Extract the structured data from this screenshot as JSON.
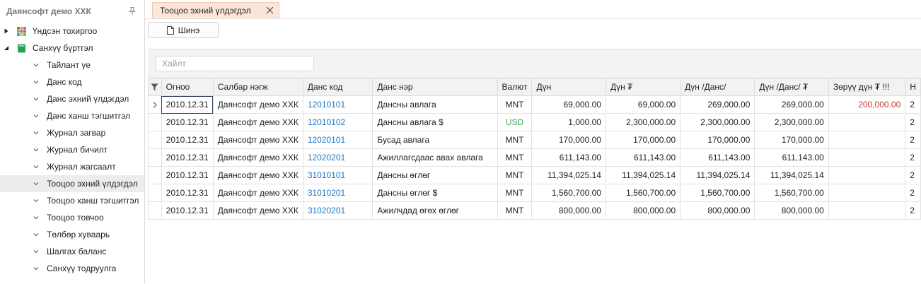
{
  "sidebar": {
    "title": "Даянсофт демо ХХК",
    "items": [
      {
        "label": "Үндсэн тохиргоо",
        "level": 0,
        "expanded": false
      },
      {
        "label": "Санхүү бүртгэл",
        "level": 0,
        "expanded": true
      },
      {
        "label": "Тайлант үе",
        "level": 1
      },
      {
        "label": "Данс код",
        "level": 1
      },
      {
        "label": "Данс эхний үлдэгдэл",
        "level": 1
      },
      {
        "label": "Данс ханш тэгшитгэл",
        "level": 1
      },
      {
        "label": "Журнал загвар",
        "level": 1
      },
      {
        "label": "Журнал бичилт",
        "level": 1
      },
      {
        "label": "Журнал жагсаалт",
        "level": 1
      },
      {
        "label": "Тооцоо эхний үлдэгдэл",
        "level": 1,
        "selected": true
      },
      {
        "label": "Тооцоо ханш тэгшитгэл",
        "level": 1
      },
      {
        "label": "Тооцоо товчоо",
        "level": 1
      },
      {
        "label": "Төлбөр хуваарь",
        "level": 1
      },
      {
        "label": "Шалгах баланс",
        "level": 1
      },
      {
        "label": "Санхүү тодруулга",
        "level": 1
      }
    ]
  },
  "tab": {
    "label": "Тооцоо эхний үлдэгдэл"
  },
  "toolbar": {
    "new_label": "Шинэ"
  },
  "search": {
    "placeholder": "Хайлт"
  },
  "grid": {
    "columns": [
      "Огноо",
      "Салбар нэгж",
      "Данс код",
      "Данс нэр",
      "Валют",
      "Дүн",
      "Дүн ₮",
      "Дүн /Данс/",
      "Дүн /Данс/ ₮",
      "Зөрүү дүн ₮ !!!"
    ],
    "rows": [
      [
        "2010.12.31",
        "Даянсофт демо ХХК",
        "12010101",
        "Дансны авлага",
        "MNT",
        "69,000.00",
        "69,000.00",
        "269,000.00",
        "269,000.00",
        "200,000.00"
      ],
      [
        "2010.12.31",
        "Даянсофт демо ХХК",
        "12010102",
        "Дансны авлага $",
        "USD",
        "1,000.00",
        "2,300,000.00",
        "2,300,000.00",
        "2,300,000.00",
        ""
      ],
      [
        "2010.12.31",
        "Даянсофт демо ХХК",
        "12020101",
        "Бусад авлага",
        "MNT",
        "170,000.00",
        "170,000.00",
        "170,000.00",
        "170,000.00",
        ""
      ],
      [
        "2010.12.31",
        "Даянсофт демо ХХК",
        "12020201",
        "Ажиллагсдаас авах авлага",
        "MNT",
        "611,143.00",
        "611,143.00",
        "611,143.00",
        "611,143.00",
        ""
      ],
      [
        "2010.12.31",
        "Даянсофт демо ХХК",
        "31010101",
        "Дансны өглөг",
        "MNT",
        "11,394,025.14",
        "11,394,025.14",
        "11,394,025.14",
        "11,394,025.14",
        ""
      ],
      [
        "2010.12.31",
        "Даянсофт демо ХХК",
        "31010201",
        "Дансны өглөг $",
        "MNT",
        "1,560,700.00",
        "1,560,700.00",
        "1,560,700.00",
        "1,560,700.00",
        ""
      ],
      [
        "2010.12.31",
        "Даянсофт демо ХХК",
        "31020201",
        "Ажилчдад өгөх өглөг",
        "MNT",
        "800,000.00",
        "800,000.00",
        "800,000.00",
        "800,000.00",
        ""
      ]
    ]
  },
  "colors": {
    "link": "#1a73c7",
    "usd": "#3fa54a",
    "diff": "#c0392b",
    "tab_bg": "#fde6d9"
  },
  "icons": {
    "pin": "pin-icon",
    "settings_node": "grid-colored-icon",
    "finance_node": "green-book-icon",
    "close": "close-icon",
    "file": "file-icon",
    "filter": "filter-icon"
  }
}
